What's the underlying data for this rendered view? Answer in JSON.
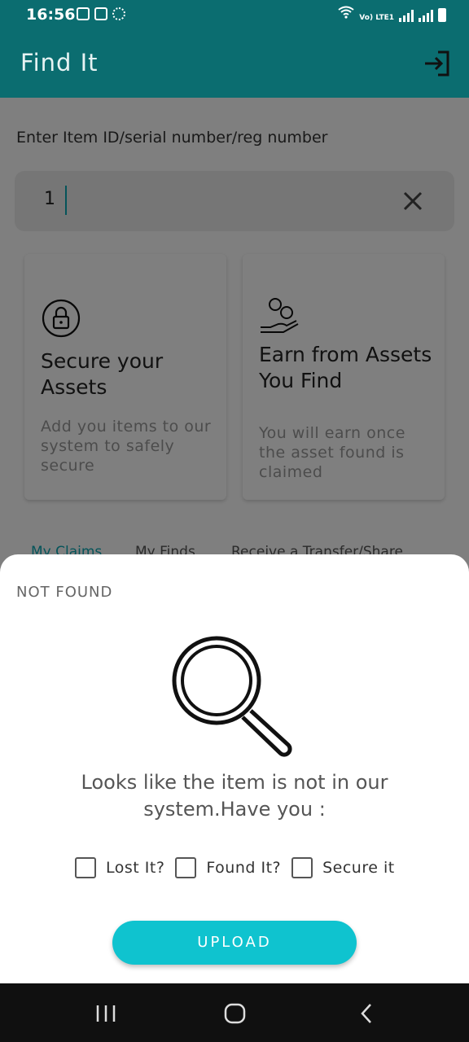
{
  "status_bar": {
    "time": "16:56",
    "network": "Vo) LTE1"
  },
  "app_bar": {
    "title": "Find It",
    "logout_icon": "logout-icon"
  },
  "search": {
    "prompt": "Enter Item ID/serial number/reg number",
    "value": "1",
    "clear_icon": "close-icon"
  },
  "cards": [
    {
      "icon": "lock-icon",
      "title": "Secure your Assets",
      "description": "Add you items to our system to safely secure"
    },
    {
      "icon": "money-hand-icon",
      "title": "Earn from Assets You Find",
      "description": "You will earn once the asset found is claimed"
    }
  ],
  "tabs": [
    {
      "label": "My Claims",
      "active": true
    },
    {
      "label": "My Finds",
      "active": false
    },
    {
      "label": "Receive a Transfer/Share",
      "active": false
    }
  ],
  "sheet": {
    "title": "NOT FOUND",
    "icon": "magnifier-icon",
    "message": "Looks like the item is not in our system.Have you :",
    "options": [
      {
        "label": "Lost It?",
        "checked": false
      },
      {
        "label": "Found It?",
        "checked": false
      },
      {
        "label": "Secure it",
        "checked": false
      }
    ],
    "upload_label": "UPLOAD"
  },
  "colors": {
    "primary": "#0b6d70",
    "accent": "#0fc3cf",
    "overlay": "#000000"
  },
  "nav_bar": {
    "recent_icon": "recent-apps-icon",
    "home_icon": "home-icon",
    "back_icon": "back-icon"
  }
}
